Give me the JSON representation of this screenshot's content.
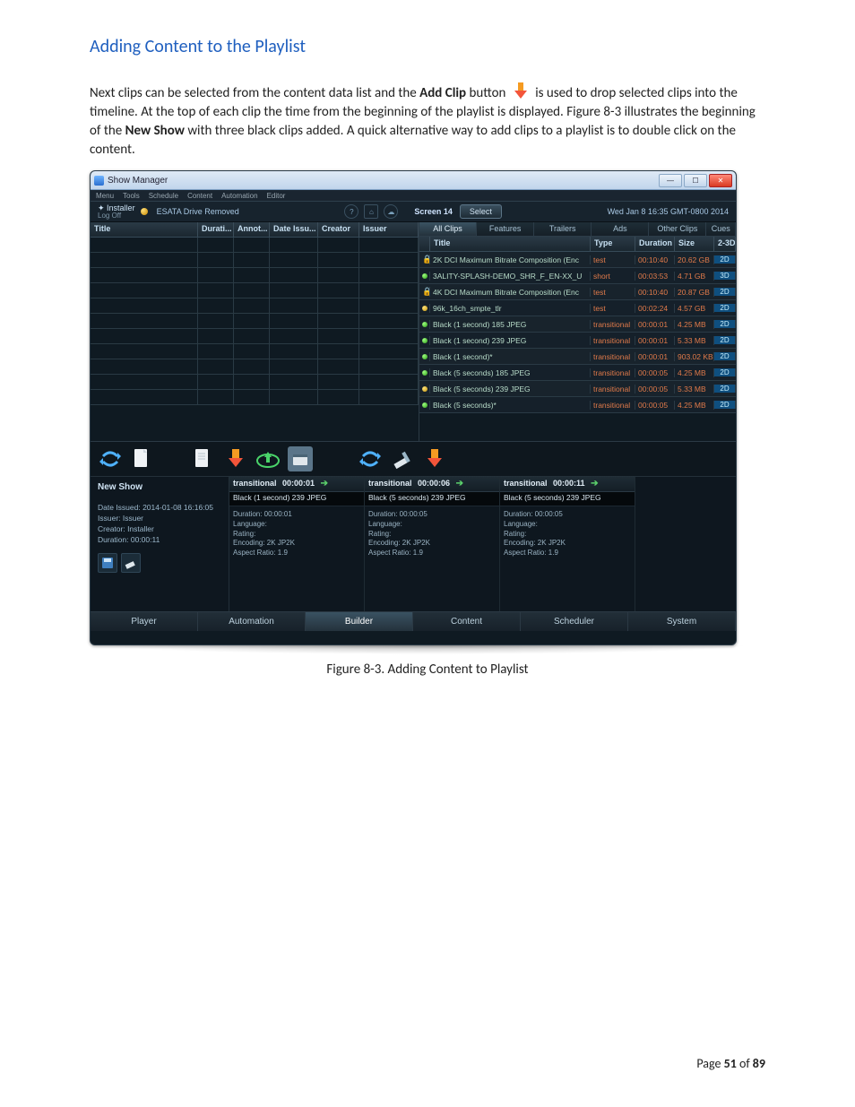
{
  "doc": {
    "heading": "Adding Content to the Playlist",
    "para_pre": "Next clips can be selected from the content data list and the ",
    "para_bold": "Add Clip",
    "para_mid": " button ",
    "para_post": " is used to drop selected clips into the timeline.  At the top of each clip the time from the beginning of the playlist is displayed.  Figure 8-3 illustrates the beginning of the ",
    "para_bold2_pre": "New Show",
    "para_end": " with three black clips added.  A quick alternative way to add clips to a playlist is to double click on the content.",
    "caption": "Figure 8-3.  Adding Content to Playlist",
    "footer_pre": "Page ",
    "footer_page": "51",
    "footer_mid": " of ",
    "footer_total": "89"
  },
  "app": {
    "title": "Show Manager",
    "menu": [
      "Menu",
      "Tools",
      "Schedule",
      "Content",
      "Automation",
      "Editor"
    ],
    "user": "Installer",
    "logoff": "Log Off",
    "esata": "ESATA Drive Removed",
    "screen": "Screen 14",
    "select_btn": "Select",
    "datetime": "Wed Jan 8 16:35 GMT-0800 2014",
    "left_cols": {
      "title": "Title",
      "durati": "Durati...",
      "annot": "Annot...",
      "dateissu": "Date Issu...",
      "creator": "Creator",
      "issuer": "Issuer"
    },
    "top_tabs": {
      "all": "All Clips",
      "features": "Features",
      "trailers": "Trailers",
      "ads": "Ads",
      "other": "Other Clips",
      "cues": "Cues"
    },
    "ct_cols": {
      "title": "Title",
      "type": "Type",
      "duration": "Duration",
      "size": "Size",
      "dim": "2-3D"
    },
    "content": [
      {
        "lock": true,
        "dot": "green",
        "title": "2K DCI Maximum Bitrate Composition (Enc",
        "type": "test",
        "dur": "00:10:40",
        "size": "20.62 GB",
        "d": "2D"
      },
      {
        "lock": false,
        "dot": "green",
        "title": "3ALITY-SPLASH-DEMO_SHR_F_EN-XX_U",
        "type": "short",
        "dur": "00:03:53",
        "size": "4.71 GB",
        "d": "3D"
      },
      {
        "lock": true,
        "dot": "green",
        "title": "4K DCI Maximum Bitrate Composition (Enc",
        "type": "test",
        "dur": "00:10:40",
        "size": "20.87 GB",
        "d": "2D"
      },
      {
        "lock": false,
        "dot": "gold",
        "title": "96k_16ch_smpte_tlr",
        "type": "test",
        "dur": "00:02:24",
        "size": "4.57 GB",
        "d": "2D"
      },
      {
        "lock": false,
        "dot": "green",
        "title": "Black (1 second) 185 JPEG",
        "type": "transitional",
        "dur": "00:00:01",
        "size": "4.25 MB",
        "d": "2D"
      },
      {
        "lock": false,
        "dot": "green",
        "title": "Black (1 second) 239 JPEG",
        "type": "transitional",
        "dur": "00:00:01",
        "size": "5.33 MB",
        "d": "2D"
      },
      {
        "lock": false,
        "dot": "green",
        "title": "Black (1 second)*",
        "type": "transitional",
        "dur": "00:00:01",
        "size": "903.02 KB",
        "d": "2D"
      },
      {
        "lock": false,
        "dot": "green",
        "title": "Black (5 seconds) 185 JPEG",
        "type": "transitional",
        "dur": "00:00:05",
        "size": "4.25 MB",
        "d": "2D"
      },
      {
        "lock": false,
        "dot": "gold",
        "title": "Black (5 seconds) 239 JPEG",
        "type": "transitional",
        "dur": "00:00:05",
        "size": "5.33 MB",
        "d": "2D"
      },
      {
        "lock": false,
        "dot": "green",
        "title": "Black (5 seconds)*",
        "type": "transitional",
        "dur": "00:00:05",
        "size": "4.25 MB",
        "d": "2D"
      }
    ],
    "show": {
      "name": "New Show",
      "date_issued": "Date Issued: 2014-01-08 16:16:05",
      "issuer": "Issuer: Issuer",
      "creator": "Creator: Installer",
      "duration": "Duration: 00:00:11"
    },
    "clips": [
      {
        "label": "transitional",
        "tc": "00:00:01",
        "title": "Black (1 second) 239 JPEG",
        "dur": "Duration: 00:00:01",
        "lang": "Language:",
        "rating": "Rating:",
        "enc": "Encoding: 2K JP2K",
        "ar": "Aspect Ratio: 1.9"
      },
      {
        "label": "transitional",
        "tc": "00:00:06",
        "title": "Black (5 seconds) 239 JPEG",
        "dur": "Duration: 00:00:05",
        "lang": "Language:",
        "rating": "Rating:",
        "enc": "Encoding: 2K JP2K",
        "ar": "Aspect Ratio: 1.9"
      },
      {
        "label": "transitional",
        "tc": "00:00:11",
        "title": "Black (5 seconds) 239 JPEG",
        "dur": "Duration: 00:00:05",
        "lang": "Language:",
        "rating": "Rating:",
        "enc": "Encoding: 2K JP2K",
        "ar": "Aspect Ratio: 1.9"
      }
    ],
    "bottom_tabs": {
      "player": "Player",
      "automation": "Automation",
      "builder": "Builder",
      "content": "Content",
      "scheduler": "Scheduler",
      "system": "System"
    }
  }
}
